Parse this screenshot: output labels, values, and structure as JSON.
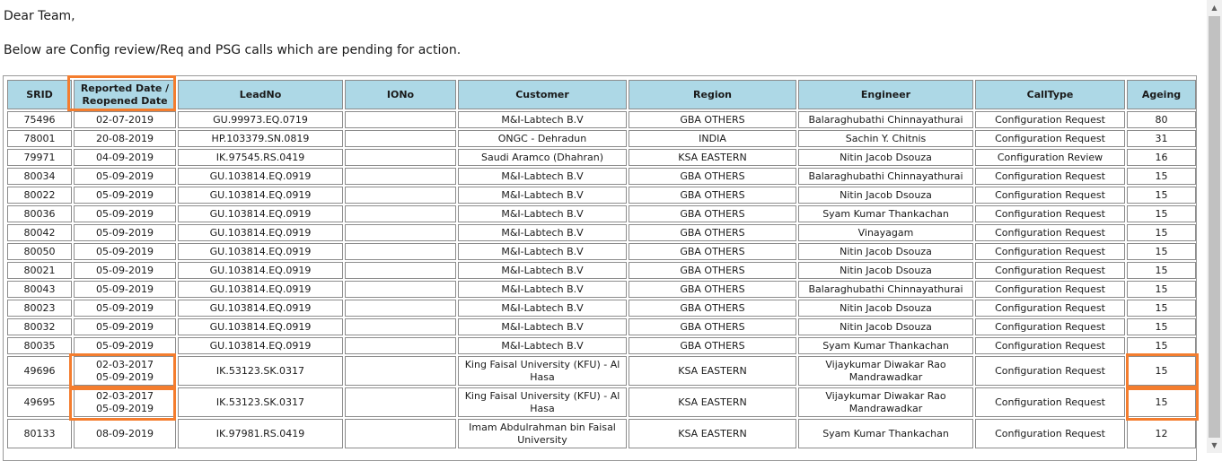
{
  "email": {
    "greeting": "Dear Team,",
    "intro": "Below are Config review/Req and PSG calls which are pending for action."
  },
  "table": {
    "headers": [
      "SRID",
      "Reported Date / Reopened Date",
      "LeadNo",
      "IONo",
      "Customer",
      "Region",
      "Engineer",
      "CallType",
      "Ageing"
    ],
    "rows": [
      {
        "srid": "75496",
        "date": "02-07-2019",
        "lead": "GU.99973.EQ.0719",
        "iono": "",
        "customer": "M&I-Labtech B.V",
        "region": "GBA OTHERS",
        "engineer": "Balaraghubathi Chinnayathurai",
        "calltype": "Configuration Request",
        "ageing": "80"
      },
      {
        "srid": "78001",
        "date": "20-08-2019",
        "lead": "HP.103379.SN.0819",
        "iono": "",
        "customer": "ONGC - Dehradun",
        "region": "INDIA",
        "engineer": "Sachin Y. Chitnis",
        "calltype": "Configuration Request",
        "ageing": "31"
      },
      {
        "srid": "79971",
        "date": "04-09-2019",
        "lead": "IK.97545.RS.0419",
        "iono": "",
        "customer": "Saudi Aramco (Dhahran)",
        "region": "KSA EASTERN",
        "engineer": "Nitin Jacob Dsouza",
        "calltype": "Configuration Review",
        "ageing": "16"
      },
      {
        "srid": "80034",
        "date": "05-09-2019",
        "lead": "GU.103814.EQ.0919",
        "iono": "",
        "customer": "M&I-Labtech B.V",
        "region": "GBA OTHERS",
        "engineer": "Balaraghubathi Chinnayathurai",
        "calltype": "Configuration Request",
        "ageing": "15"
      },
      {
        "srid": "80022",
        "date": "05-09-2019",
        "lead": "GU.103814.EQ.0919",
        "iono": "",
        "customer": "M&I-Labtech B.V",
        "region": "GBA OTHERS",
        "engineer": "Nitin Jacob Dsouza",
        "calltype": "Configuration Request",
        "ageing": "15"
      },
      {
        "srid": "80036",
        "date": "05-09-2019",
        "lead": "GU.103814.EQ.0919",
        "iono": "",
        "customer": "M&I-Labtech B.V",
        "region": "GBA OTHERS",
        "engineer": "Syam Kumar Thankachan",
        "calltype": "Configuration Request",
        "ageing": "15"
      },
      {
        "srid": "80042",
        "date": "05-09-2019",
        "lead": "GU.103814.EQ.0919",
        "iono": "",
        "customer": "M&I-Labtech B.V",
        "region": "GBA OTHERS",
        "engineer": "Vinayagam",
        "calltype": "Configuration Request",
        "ageing": "15"
      },
      {
        "srid": "80050",
        "date": "05-09-2019",
        "lead": "GU.103814.EQ.0919",
        "iono": "",
        "customer": "M&I-Labtech B.V",
        "region": "GBA OTHERS",
        "engineer": "Nitin Jacob Dsouza",
        "calltype": "Configuration Request",
        "ageing": "15"
      },
      {
        "srid": "80021",
        "date": "05-09-2019",
        "lead": "GU.103814.EQ.0919",
        "iono": "",
        "customer": "M&I-Labtech B.V",
        "region": "GBA OTHERS",
        "engineer": "Nitin Jacob Dsouza",
        "calltype": "Configuration Request",
        "ageing": "15"
      },
      {
        "srid": "80043",
        "date": "05-09-2019",
        "lead": "GU.103814.EQ.0919",
        "iono": "",
        "customer": "M&I-Labtech B.V",
        "region": "GBA OTHERS",
        "engineer": "Balaraghubathi Chinnayathurai",
        "calltype": "Configuration Request",
        "ageing": "15"
      },
      {
        "srid": "80023",
        "date": "05-09-2019",
        "lead": "GU.103814.EQ.0919",
        "iono": "",
        "customer": "M&I-Labtech B.V",
        "region": "GBA OTHERS",
        "engineer": "Nitin Jacob Dsouza",
        "calltype": "Configuration Request",
        "ageing": "15"
      },
      {
        "srid": "80032",
        "date": "05-09-2019",
        "lead": "GU.103814.EQ.0919",
        "iono": "",
        "customer": "M&I-Labtech B.V",
        "region": "GBA OTHERS",
        "engineer": "Nitin Jacob Dsouza",
        "calltype": "Configuration Request",
        "ageing": "15"
      },
      {
        "srid": "80035",
        "date": "05-09-2019",
        "lead": "GU.103814.EQ.0919",
        "iono": "",
        "customer": "M&I-Labtech B.V",
        "region": "GBA OTHERS",
        "engineer": "Syam Kumar Thankachan",
        "calltype": "Configuration Request",
        "ageing": "15"
      },
      {
        "srid": "49696",
        "date": "02-03-2017\n05-09-2019",
        "lead": "IK.53123.SK.0317",
        "iono": "",
        "customer": "King Faisal University (KFU) - Al Hasa",
        "region": "KSA EASTERN",
        "engineer": "Vijaykumar Diwakar Rao Mandrawadkar",
        "calltype": "Configuration Request",
        "ageing": "15"
      },
      {
        "srid": "49695",
        "date": "02-03-2017\n05-09-2019",
        "lead": "IK.53123.SK.0317",
        "iono": "",
        "customer": "King Faisal University (KFU) - Al Hasa",
        "region": "KSA EASTERN",
        "engineer": "Vijaykumar Diwakar Rao Mandrawadkar",
        "calltype": "Configuration Request",
        "ageing": "15"
      },
      {
        "srid": "80133",
        "date": "08-09-2019",
        "lead": "IK.97981.RS.0419",
        "iono": "",
        "customer": "Imam Abdulrahman bin Faisal University",
        "region": "KSA EASTERN",
        "engineer": "Syam Kumar Thankachan",
        "calltype": "Configuration Request",
        "ageing": "12"
      }
    ]
  },
  "colors": {
    "header_bg": "#add8e6",
    "highlight": "#f47d2e"
  },
  "scrollbar": {
    "up_icon": "scroll-up-arrow",
    "down_icon": "scroll-down-arrow"
  }
}
